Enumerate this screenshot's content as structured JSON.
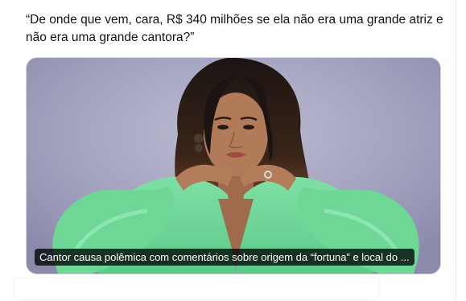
{
  "post": {
    "text": "“De onde que vem, cara, R$ 340 milhões se ela não era uma grande atriz e não era uma grande cantora?”"
  },
  "link_card": {
    "caption": "Cantor causa polêmica com comentários sobre origem da “fortuna” e local do ..."
  }
}
